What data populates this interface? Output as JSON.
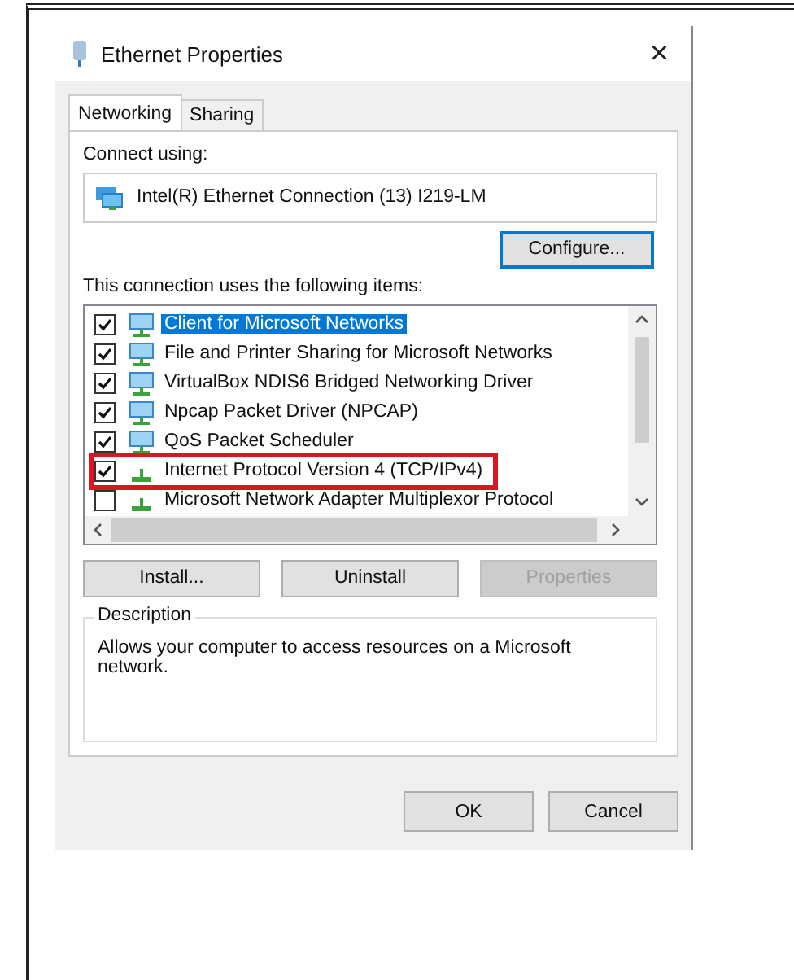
{
  "window": {
    "title": "Ethernet Properties",
    "close": "×"
  },
  "tabs": [
    {
      "label": "Networking",
      "selected": true
    },
    {
      "label": "Sharing",
      "selected": false
    }
  ],
  "connect_using": {
    "label": "Connect using:",
    "adapter": "Intel(R) Ethernet Connection (13) I219-LM",
    "configure_button": "Configure..."
  },
  "items_label": "This connection uses the following items:",
  "items": [
    {
      "label": "Client for Microsoft Networks",
      "kind": "client",
      "checked": true,
      "selected": true,
      "highlighted": false
    },
    {
      "label": "File and Printer Sharing for Microsoft Networks",
      "kind": "client",
      "checked": true,
      "selected": false,
      "highlighted": false
    },
    {
      "label": "VirtualBox NDIS6 Bridged Networking Driver",
      "kind": "client",
      "checked": true,
      "selected": false,
      "highlighted": false
    },
    {
      "label": "Npcap Packet Driver (NPCAP)",
      "kind": "client",
      "checked": true,
      "selected": false,
      "highlighted": false
    },
    {
      "label": "QoS Packet Scheduler",
      "kind": "client",
      "checked": true,
      "selected": false,
      "highlighted": false
    },
    {
      "label": "Internet Protocol Version 4 (TCP/IPv4)",
      "kind": "protocol",
      "checked": true,
      "selected": false,
      "highlighted": true
    },
    {
      "label": "Microsoft Network Adapter Multiplexor Protocol",
      "kind": "protocol",
      "checked": false,
      "selected": false,
      "highlighted": false
    }
  ],
  "item_buttons": [
    {
      "label": "Install...",
      "disabled": false
    },
    {
      "label": "Uninstall",
      "disabled": false
    },
    {
      "label": "Properties",
      "disabled": true
    }
  ],
  "description": {
    "title": "Description",
    "text": "Allows your computer to access resources on a Microsoft network."
  },
  "dialog_buttons": [
    "OK",
    "Cancel"
  ]
}
